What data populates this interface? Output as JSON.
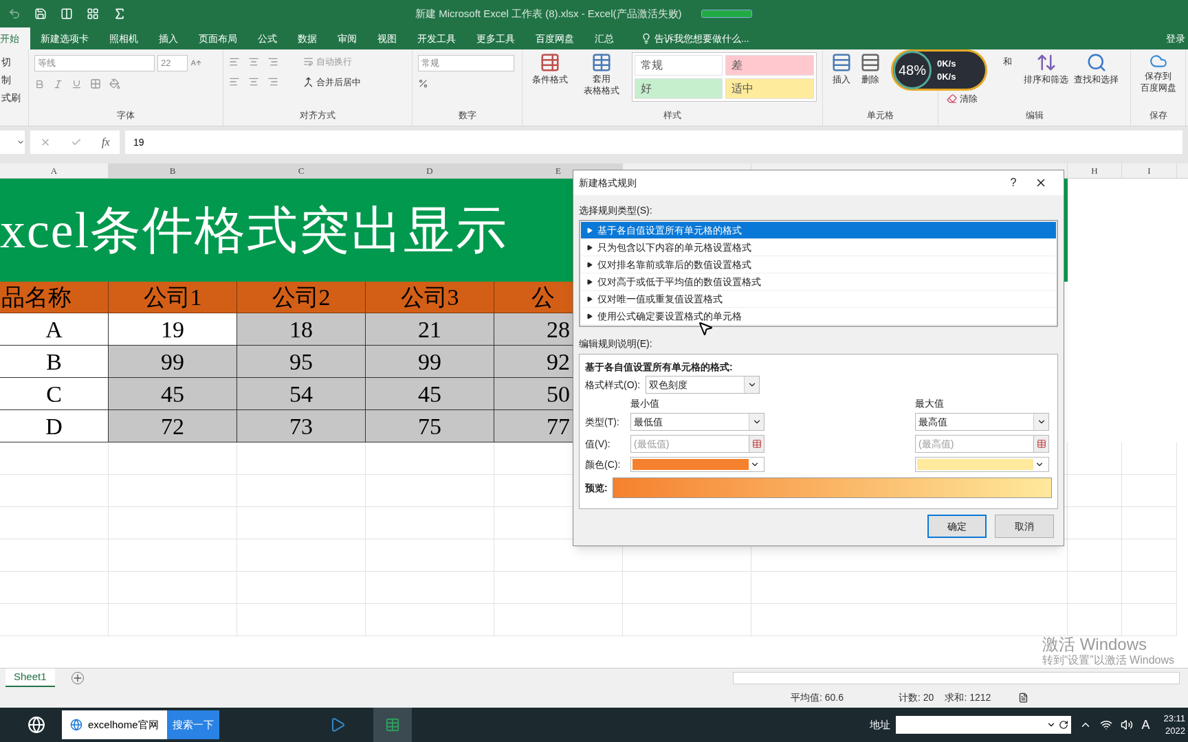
{
  "title_bar": {
    "title": "新建 Microsoft Excel 工作表 (8).xlsx - Excel(产品激活失败)"
  },
  "ribbon_tabs": [
    {
      "label": "开始",
      "selected": true
    },
    {
      "label": "新建选项卡",
      "selected": false
    },
    {
      "label": "照相机",
      "selected": false
    },
    {
      "label": "插入",
      "selected": false
    },
    {
      "label": "页面布局",
      "selected": false
    },
    {
      "label": "公式",
      "selected": false
    },
    {
      "label": "数据",
      "selected": false
    },
    {
      "label": "审阅",
      "selected": false
    },
    {
      "label": "视图",
      "selected": false
    },
    {
      "label": "开发工具",
      "selected": false
    },
    {
      "label": "更多工具",
      "selected": false
    },
    {
      "label": "百度网盘",
      "selected": false
    },
    {
      "label": "汇总",
      "selected": false
    }
  ],
  "tell_me": "告诉我您想要做什么...",
  "sign_in": "登录",
  "ribbon": {
    "clipboard": [
      "切",
      "制",
      "式刷"
    ],
    "font": {
      "name": "等线",
      "size": "22",
      "label": "字体"
    },
    "alignment": {
      "wrap": "自动换行",
      "merge": "合并后居中",
      "label": "对齐方式"
    },
    "number": {
      "format": "常规",
      "label": "数字"
    },
    "styles": {
      "conditional": "条件格式",
      "table_format": [
        "套用",
        "表格格式"
      ],
      "label": "样式",
      "cell_styles": [
        {
          "label": "常规",
          "color": "#ffffff"
        },
        {
          "label": "差",
          "color": "#ffc7ce"
        },
        {
          "label": "好",
          "color": "#c6efce"
        },
        {
          "label": "适中",
          "color": "#ffeb9c"
        }
      ]
    },
    "cells": {
      "insert": "插入",
      "delete": "删除",
      "label": "单元格"
    },
    "editing": {
      "autosum": "和",
      "clear": "清除",
      "sort": "排序和筛选",
      "find": "查找和选择",
      "label": "编辑"
    },
    "save": {
      "button": [
        "保存到",
        "百度网盘"
      ],
      "label": "保存"
    }
  },
  "formula_bar": {
    "fx": "fx",
    "value": "19"
  },
  "columns": [
    "A",
    "B",
    "C",
    "D",
    "E",
    "H",
    "I"
  ],
  "sheet": {
    "title": "xcel条件格式突出显示",
    "header": [
      "品名称",
      "公司1",
      "公司2",
      "公司3",
      "公"
    ],
    "rows": [
      {
        "label": "A",
        "cells": [
          {
            "value": "19",
            "active": true
          },
          {
            "value": "18",
            "active": false
          },
          {
            "value": "21",
            "active": false
          },
          {
            "value": "28",
            "active": false
          }
        ]
      },
      {
        "label": "B",
        "cells": [
          {
            "value": "99",
            "active": false
          },
          {
            "value": "95",
            "active": false
          },
          {
            "value": "99",
            "active": false
          },
          {
            "value": "92",
            "active": false
          }
        ]
      },
      {
        "label": "C",
        "cells": [
          {
            "value": "45",
            "active": false
          },
          {
            "value": "54",
            "active": false
          },
          {
            "value": "45",
            "active": false
          },
          {
            "value": "50",
            "active": false
          }
        ]
      },
      {
        "label": "D",
        "cells": [
          {
            "value": "72",
            "active": false
          },
          {
            "value": "73",
            "active": false
          },
          {
            "value": "75",
            "active": false
          },
          {
            "value": "77",
            "active": false
          }
        ]
      }
    ]
  },
  "dialog": {
    "title": "新建格式规则",
    "help": "?",
    "rule_type_label": "选择规则类型(S):",
    "rule_types": [
      {
        "label": "基于各自值设置所有单元格的格式",
        "selected": true
      },
      {
        "label": "只为包含以下内容的单元格设置格式",
        "selected": false
      },
      {
        "label": "仅对排名靠前或靠后的数值设置格式",
        "selected": false
      },
      {
        "label": "仅对高于或低于平均值的数值设置格式",
        "selected": false
      },
      {
        "label": "仅对唯一值或重复值设置格式",
        "selected": false
      },
      {
        "label": "使用公式确定要设置格式的单元格",
        "selected": false
      }
    ],
    "edit_label": "编辑规则说明(E):",
    "heading": "基于各自值设置所有单元格的格式:",
    "style_label": "格式样式(O):",
    "style_value": "双色刻度",
    "min": {
      "heading": "最小值",
      "type": "最低值",
      "placeholder": "(最低值)",
      "color": "#f5812e"
    },
    "max": {
      "heading": "最大值",
      "type": "最高值",
      "placeholder": "(最高值)",
      "color": "#ffe99c"
    },
    "type_label": "类型(T):",
    "value_label": "值(V):",
    "color_label": "颜色(C):",
    "preview_label": "预览:",
    "buttons": [
      "确定",
      "取消"
    ]
  },
  "sheet_tabs": [
    {
      "label": "Sheet1",
      "selected": true
    }
  ],
  "status_bar": {
    "average": "平均值: 60.6",
    "count": "计数: 20",
    "sum": "求和: 1212"
  },
  "taskbar": {
    "browser_tab": "excelhome官网",
    "search_button": "搜索一下",
    "address_label": "地址",
    "ime": "A",
    "time": "23:11",
    "date": "2022"
  },
  "speed_widget": {
    "percent": "48%",
    "upload": "0K/s",
    "download": "0K/s"
  },
  "activation_notice": {
    "title": "激活 Windows",
    "text": "转到“设置”以激活 Windows"
  }
}
